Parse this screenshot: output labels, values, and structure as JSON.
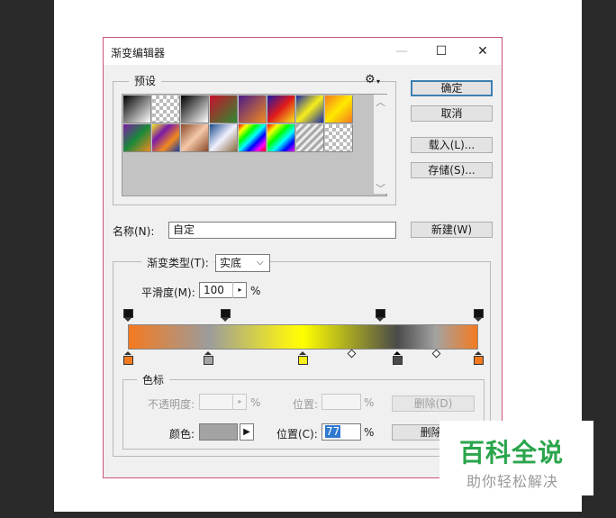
{
  "window": {
    "title": "渐变编辑器",
    "minimize_glyph": "—",
    "maximize_glyph": "☐",
    "close_glyph": "✕"
  },
  "presets": {
    "legend": "预设",
    "gear_glyph": "⚙",
    "scroll_up": "︿",
    "scroll_down": "﹀",
    "swatches": [
      {
        "name": "black-white"
      },
      {
        "name": "transparent-white"
      },
      {
        "name": "black-transparent"
      },
      {
        "name": "red-green"
      },
      {
        "name": "violet-orange"
      },
      {
        "name": "blue-red-yellow"
      },
      {
        "name": "blue-yellow-blue"
      },
      {
        "name": "orange-yellow-orange"
      },
      {
        "name": "violet-green-orange"
      },
      {
        "name": "yellow-violet-orange-blue"
      },
      {
        "name": "copper"
      },
      {
        "name": "chrome"
      },
      {
        "name": "spectrum"
      },
      {
        "name": "transparent-rainbow"
      },
      {
        "name": "transparent-stripes"
      },
      {
        "name": "transparent"
      }
    ]
  },
  "buttons": {
    "ok": "确定",
    "cancel": "取消",
    "load": "载入(L)...",
    "save": "存储(S)...",
    "new": "新建(W)",
    "delete_opacity": "删除(D)",
    "delete_color": "删除("
  },
  "name_field": {
    "label": "名称(N):",
    "value": "自定"
  },
  "gradient": {
    "type_label": "渐变类型(T):",
    "type_value": "实底",
    "smoothness_label": "平滑度(M):",
    "smoothness_value": "100",
    "percent": "%",
    "colors": [
      "#f47a20",
      "#9c9c9c",
      "#f6ee1a",
      "#ffff00",
      "#4a4a4a",
      "#a3a3a3",
      "#f47a20"
    ],
    "opacity_stops": [
      0,
      28,
      72,
      100
    ],
    "color_stops": [
      {
        "pos": 0,
        "color": "#f47a20"
      },
      {
        "pos": 23,
        "color": "#a3a3a3"
      },
      {
        "pos": 50,
        "color": "#f6ee1a"
      },
      {
        "pos": 77,
        "color": "#4a4a4a",
        "selected": true
      },
      {
        "pos": 100,
        "color": "#f47a20"
      }
    ],
    "midpoints": [
      64,
      88
    ]
  },
  "stops": {
    "legend": "色标",
    "opacity_label": "不透明度:",
    "opacity_value": "",
    "opacity_unit": "%",
    "opacity_location_label": "位置:",
    "opacity_location_value": "",
    "opacity_location_unit": "%",
    "color_label": "颜色:",
    "color_value": "#a3a3a3",
    "color_location_label": "位置(C):",
    "color_location_value": "77",
    "color_location_unit": "%"
  },
  "watermark": {
    "title": "百科全说",
    "subtitle": "助你轻松解决",
    "title_color": "#2aa54b"
  }
}
